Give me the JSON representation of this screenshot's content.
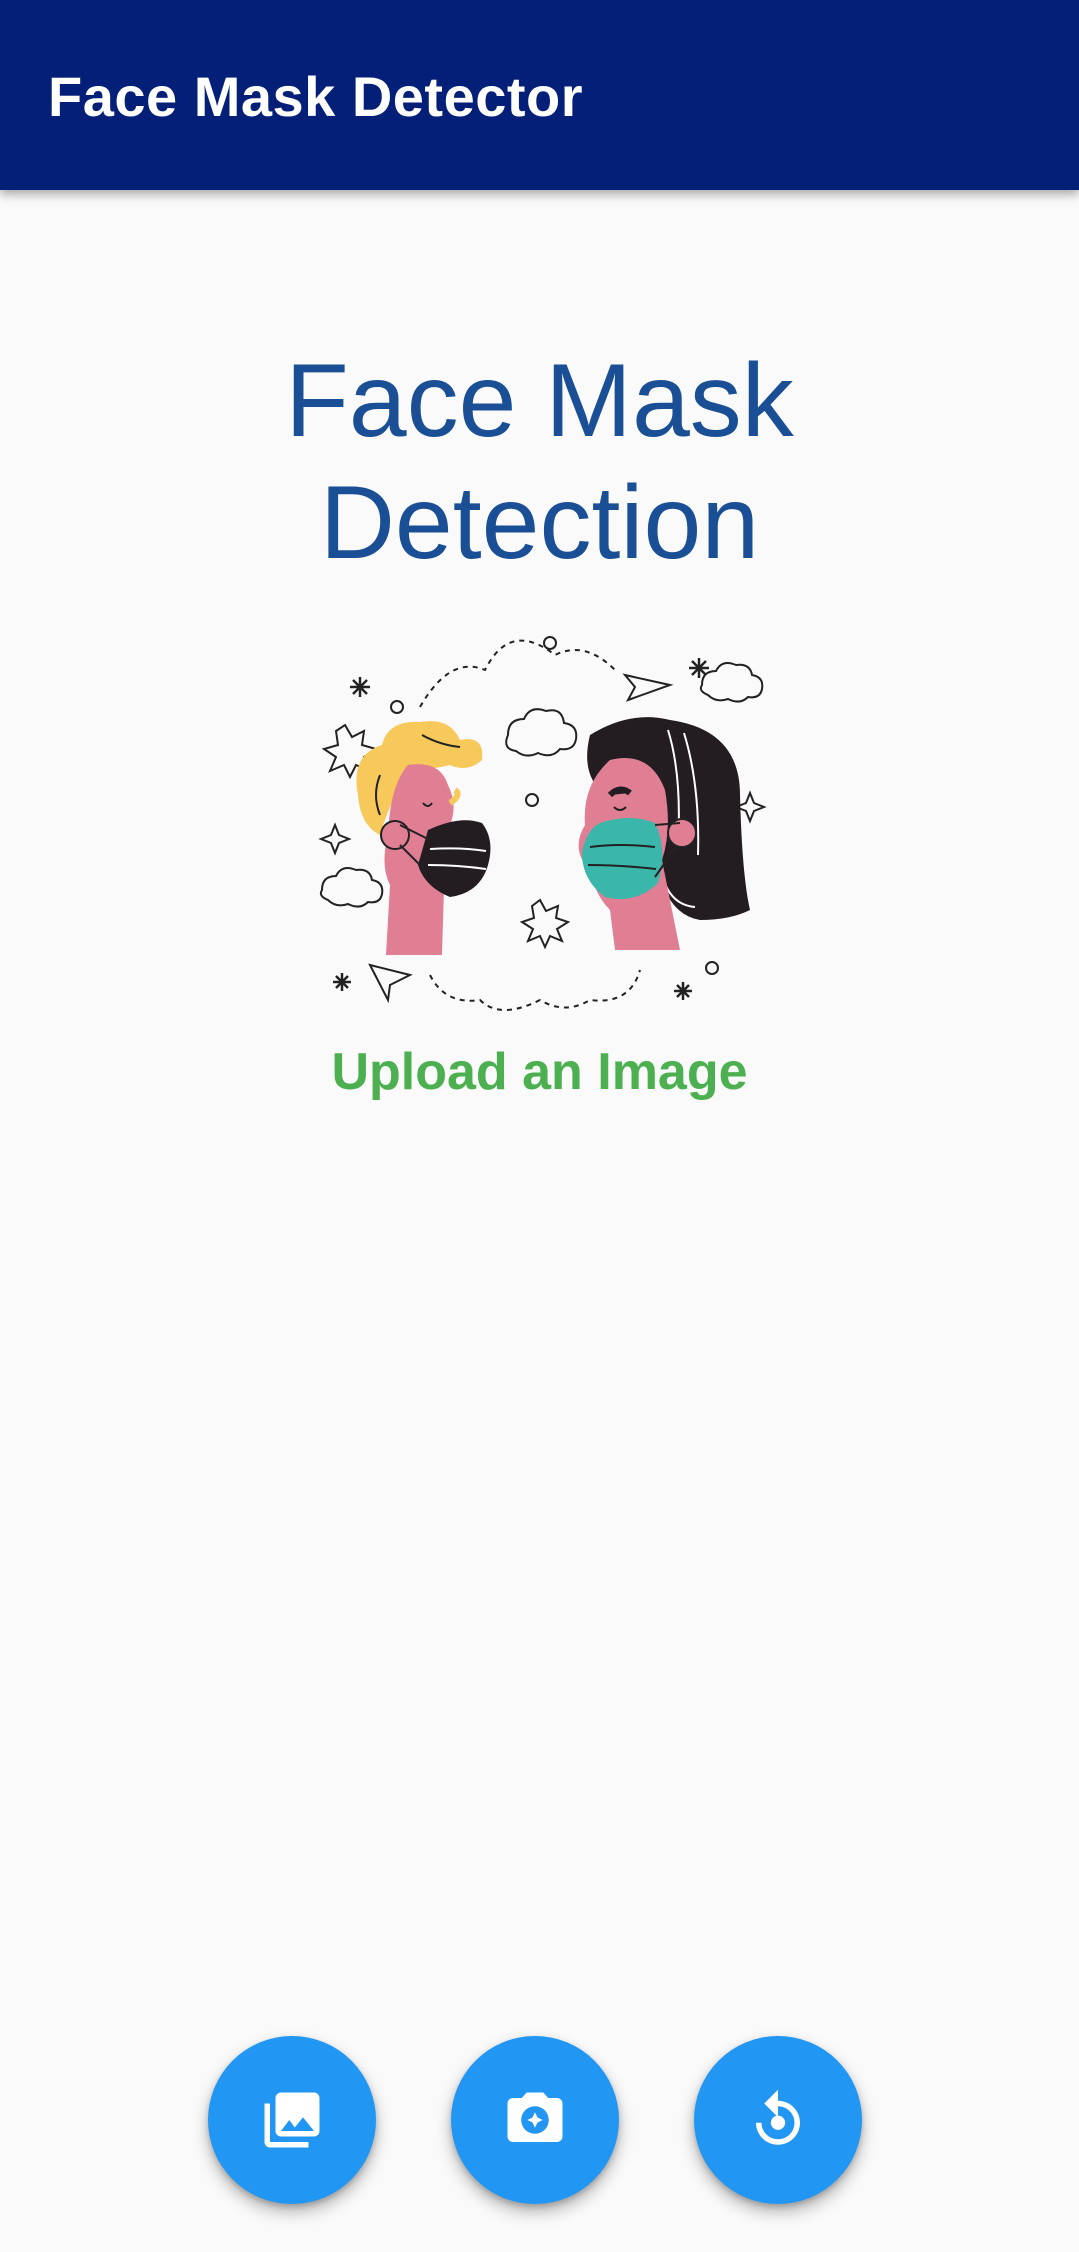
{
  "app_bar": {
    "title": "Face Mask Detector",
    "background_color": "#041f77"
  },
  "main": {
    "heading_line1": "Face Mask",
    "heading_line2": "Detection",
    "heading_color": "#1a4f96",
    "illustration": "two-people-wearing-face-masks-illustration",
    "upload_prompt": "Upload an Image",
    "upload_prompt_color": "#4caf50"
  },
  "actions": [
    {
      "icon": "photo-library-icon",
      "purpose": "gallery"
    },
    {
      "icon": "camera-icon",
      "purpose": "camera"
    },
    {
      "icon": "reset-icon",
      "purpose": "reset"
    }
  ],
  "colors": {
    "fab": "#2196f3",
    "background": "#fafafa"
  }
}
